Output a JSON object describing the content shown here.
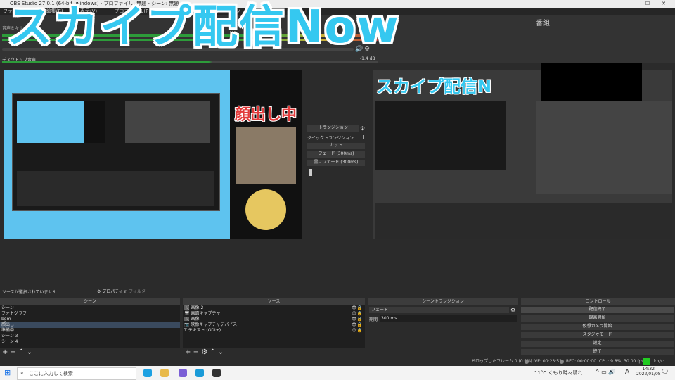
{
  "window": {
    "title": "OBS Studio 27.0.1 (64-bit, windows) - プロファイル: 無題 - シーン: 無題",
    "min": "–",
    "max": "☐",
    "close": "✕"
  },
  "menu": [
    "ファイル(F)",
    "編集(E)",
    "表示(V)",
    "プロファイル(P)",
    "シーンコレクション(S)",
    "ツール(T)"
  ],
  "overlay_text": "スカイプ配信Now",
  "program_label": "番組",
  "mixer": {
    "section": "音声ミキサー",
    "desktop_audio": "デスクトップ音声",
    "db": "-1.4 dB"
  },
  "preview_overlay": "顔出し中",
  "transition_panel": {
    "header": "トランジション",
    "quick": "クイックトランジション",
    "cut": "カット",
    "fade": "フェード (300ms)",
    "fade_black": "黒にフェード (300ms)"
  },
  "program_overlay": "スカイプ配信N",
  "source_info": {
    "text": "ソースが選択されていません",
    "properties": "プロパティ",
    "filters": "フィルタ"
  },
  "scenes": {
    "header": "シーン",
    "items": [
      "シーン",
      "フォトグラフ",
      "bgm",
      "顔出し",
      "準備中",
      "シーン 3",
      "シーン 4"
    ],
    "selected": 3
  },
  "sources": {
    "header": "ソース",
    "items": [
      {
        "icon": "🖼",
        "label": "画像 2"
      },
      {
        "icon": "🖥",
        "label": "画面キャプチャ"
      },
      {
        "icon": "🖼",
        "label": "画像"
      },
      {
        "icon": "📷",
        "label": "映像キャプチャデバイス"
      },
      {
        "icon": "T",
        "label": "テキスト (GDI+)"
      }
    ]
  },
  "scene_transitions": {
    "header": "シーントランジション",
    "type": "フェード",
    "duration_label": "期間",
    "duration": "300 ms"
  },
  "controls": {
    "header": "コントロール",
    "buttons": [
      "配信終了",
      "録画開始",
      "仮想カメラ開始",
      "スタジオモード",
      "設定",
      "終了"
    ]
  },
  "status": {
    "dropped": "ドロップしたフレーム 0 (0.0%)",
    "live": "LIVE: 00:23:53",
    "rec": "REC: 00:00:00",
    "cpu": "CPU: 9.8%, 30.00 fps",
    "kbps": "kb/s: 2679"
  },
  "taskbar": {
    "search": "ここに入力して検索",
    "weather": "11°C くもり時々晴れ",
    "time": "14:32",
    "date": "2022/01/08",
    "ime": "A"
  },
  "colors": {
    "accent": "#35c8f0",
    "live_green": "#22cc22",
    "preview_bg": "#5ec3ef"
  }
}
